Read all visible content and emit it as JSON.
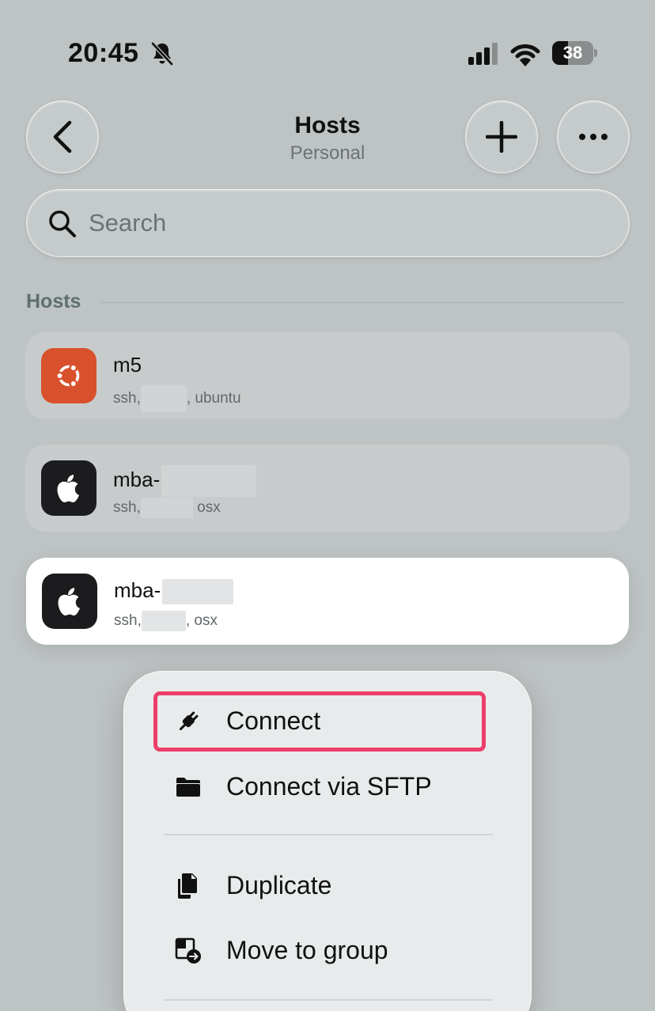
{
  "status_bar": {
    "time": "20:45",
    "battery": "38",
    "battery_level": 0.38
  },
  "header": {
    "title": "Hosts",
    "subtitle": "Personal"
  },
  "search": {
    "placeholder": "Search",
    "value": ""
  },
  "section": {
    "title": "Hosts"
  },
  "hosts": [
    {
      "name": "m5",
      "meta_prefix": "ssh,",
      "meta_suffix": ", ubuntu",
      "os_icon": "ubuntu-icon"
    },
    {
      "name": "mba-",
      "meta_prefix": "ssh,",
      "meta_suffix": " osx",
      "os_icon": "apple-icon"
    },
    {
      "name": "mba-",
      "meta_prefix": "ssh,",
      "meta_suffix": ", osx",
      "os_icon": "apple-icon"
    }
  ],
  "context_menu": {
    "items": [
      {
        "label": "Connect",
        "icon": "plug-icon"
      },
      {
        "label": "Connect via SFTP",
        "icon": "folder-icon"
      },
      {
        "label": "Duplicate",
        "icon": "duplicate-icon"
      },
      {
        "label": "Move to group",
        "icon": "move-to-group-icon"
      }
    ]
  },
  "colors": {
    "background": "#bec3c3",
    "ubuntu": "#d9512c",
    "highlight": "#ec3d6a"
  }
}
